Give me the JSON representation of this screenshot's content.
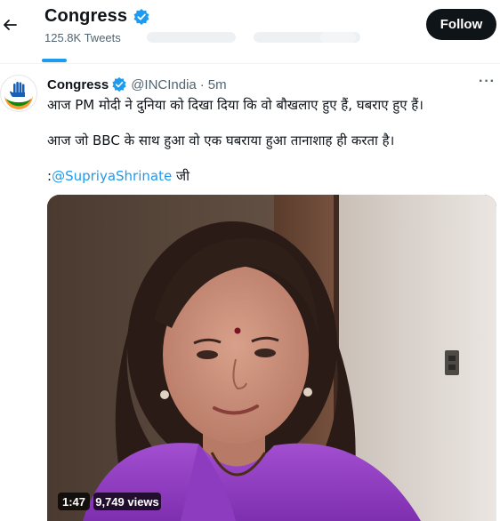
{
  "header": {
    "name": "Congress",
    "tweet_count": "125.8K Tweets",
    "follow_label": "Follow"
  },
  "tweet": {
    "author_name": "Congress",
    "handle": "@INCIndia",
    "separator": "·",
    "time": "5m",
    "more": "···",
    "line1": "आज PM मोदी ने दुनिया को दिखा दिया कि वो बौखलाए हुए हैं, घबराए हुए हैं।",
    "line2": "आज जो BBC के साथ हुआ वो एक घबराया हुआ तानाशाह ही करता है।",
    "line3_prefix": ":",
    "mention": "@SupriyaShrinate",
    "line3_suffix": " जी"
  },
  "video": {
    "duration": "1:47",
    "views": "9,749 views"
  },
  "colors": {
    "accent": "#1d9bf0",
    "follow_bg": "#0f1419",
    "muted_text": "#536471",
    "verified": "#1d9bf0"
  }
}
